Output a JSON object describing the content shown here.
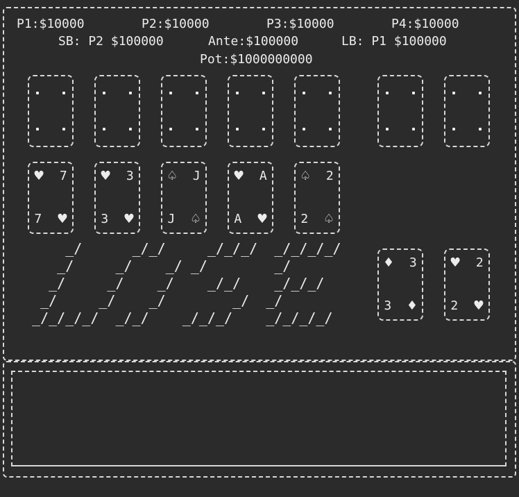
{
  "header": {
    "players": [
      {
        "label": "P1:$10000"
      },
      {
        "label": "P2:$10000"
      },
      {
        "label": "P3:$10000"
      },
      {
        "label": "P4:$10000"
      }
    ],
    "blinds": {
      "small_blind": "SB: P2 $100000",
      "ante": "Ante:$100000",
      "large_blind": "LB: P1 $100000"
    },
    "pot": "Pot:$1000000000"
  },
  "opponent_cards": [
    {
      "face": "down"
    },
    {
      "face": "down"
    },
    {
      "face": "down"
    },
    {
      "face": "down"
    },
    {
      "face": "down"
    },
    {
      "face": "down"
    },
    {
      "face": "down"
    }
  ],
  "board_cards": [
    {
      "rank": "7",
      "suit": "♥",
      "suit_name": "heart-icon"
    },
    {
      "rank": "3",
      "suit": "♥",
      "suit_name": "heart-icon"
    },
    {
      "rank": "J",
      "suit": "♤",
      "suit_name": "spade-outline-icon"
    },
    {
      "rank": "A",
      "suit": "♥",
      "suit_name": "heart-icon"
    },
    {
      "rank": "2",
      "suit": "♤",
      "suit_name": "spade-outline-icon"
    }
  ],
  "player_hand": [
    {
      "rank": "3",
      "suit": "♦",
      "suit_name": "diamond-icon"
    },
    {
      "rank": "2",
      "suit": "♥",
      "suit_name": "heart-icon"
    }
  ],
  "ascii_art": [
    "     _/      _/_/     _/_/_/  _/_/_/_/",
    "    _/     _/    _/ _/        _/      ",
    "   _/     _/    _/    _/_/    _/_/_/  ",
    "  _/     _/    _/        _/  _/       ",
    " _/_/_/_/  _/_/    _/_/_/    _/_/_/_/ "
  ],
  "ascii_art_text": "LOSE",
  "message_box": {
    "text": ""
  },
  "colors": {
    "background": "#2b2b2b",
    "foreground": "#ececec",
    "border": "#d8d8d8"
  }
}
